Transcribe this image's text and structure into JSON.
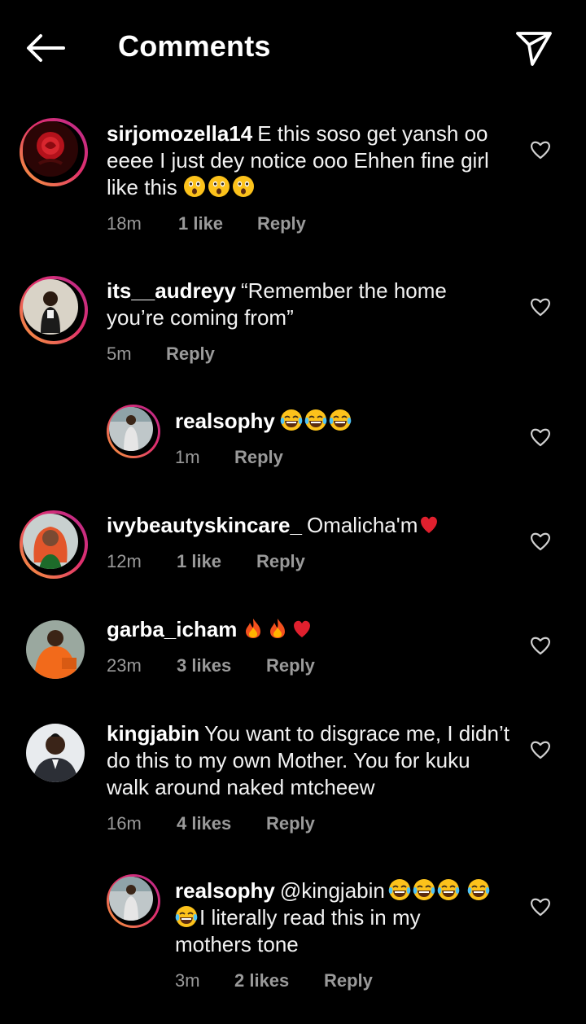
{
  "header": {
    "title": "Comments",
    "back_icon": "arrow-left-icon",
    "send_icon": "paper-plane-icon"
  },
  "colors": {
    "background": "#000000",
    "text": "#ffffff",
    "meta": "#9a9a9a",
    "story_ring": "#e1306c"
  },
  "comments": [
    {
      "user": "sirjomozella14",
      "text": "E this soso get yansh oo eeee I just dey notice ooo Ehhen fine girl like this",
      "emoji": [
        "astonished-face",
        "astonished-face",
        "astonished-face"
      ],
      "time": "18m",
      "likes": "1 like",
      "reply": "Reply"
    },
    {
      "user": "its__audreyy",
      "text": "“Remember the home you’re coming from”",
      "time": "5m",
      "reply": "Reply"
    },
    {
      "user": "realsophy",
      "text": "",
      "emoji": [
        "laughing-tears-face",
        "laughing-tears-face",
        "laughing-tears-face"
      ],
      "time": "1m",
      "reply": "Reply"
    },
    {
      "user": "ivybeautyskincare_",
      "text": "Omalicha'm",
      "emoji": [
        "red-heart"
      ],
      "time": "12m",
      "likes": "1 like",
      "reply": "Reply"
    },
    {
      "user": "garba_icham",
      "text": "",
      "emoji": [
        "fire",
        "fire",
        "red-heart"
      ],
      "time": "23m",
      "likes": "3 likes",
      "reply": "Reply"
    },
    {
      "user": "kingjabin",
      "text": "You want to disgrace me, I didn’t do this to my own Mother. You for kuku walk around naked mtcheew",
      "time": "16m",
      "likes": "4 likes",
      "reply": "Reply"
    },
    {
      "user": "realsophy",
      "mention": "@kingjabin",
      "text": "I literally read this in my mothers tone",
      "emoji": [
        "laughing-tears-face",
        "laughing-tears-face",
        "laughing-tears-face",
        "laughing-tears-face",
        "laughing-tears-face"
      ],
      "time": "3m",
      "likes": "2 likes",
      "reply": "Reply"
    }
  ]
}
